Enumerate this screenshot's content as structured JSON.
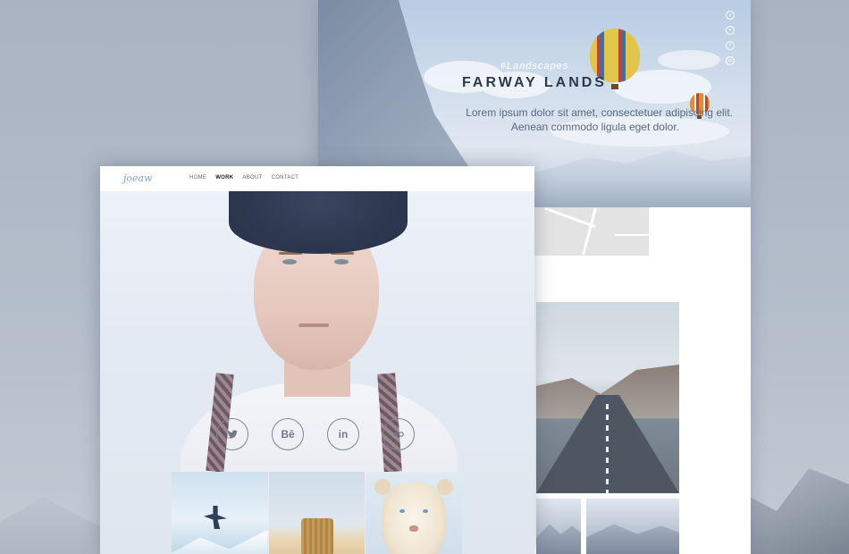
{
  "back_page": {
    "hero": {
      "tag": "#Landscapes",
      "title": "FARWAY LANDS",
      "text_line1": "Lorem ipsum dolor sit amet, consectetuer adipiscing elit.",
      "text_line2": "Aenean commodo ligula eget dolor."
    },
    "social_icons": [
      "dribbble-icon",
      "twitter-icon",
      "facebook-icon",
      "instagram-icon"
    ]
  },
  "front_page": {
    "logo": "joeaw",
    "nav": [
      {
        "label": "HOME",
        "active": false
      },
      {
        "label": "WORK",
        "active": true
      },
      {
        "label": "ABOUT",
        "active": false
      },
      {
        "label": "CONTACT",
        "active": false
      }
    ],
    "social": {
      "behance_label": "Bē",
      "linkedin_label": "in",
      "icons": [
        "twitter-icon",
        "behance-icon",
        "linkedin-icon",
        "flickr-icon"
      ]
    }
  }
}
